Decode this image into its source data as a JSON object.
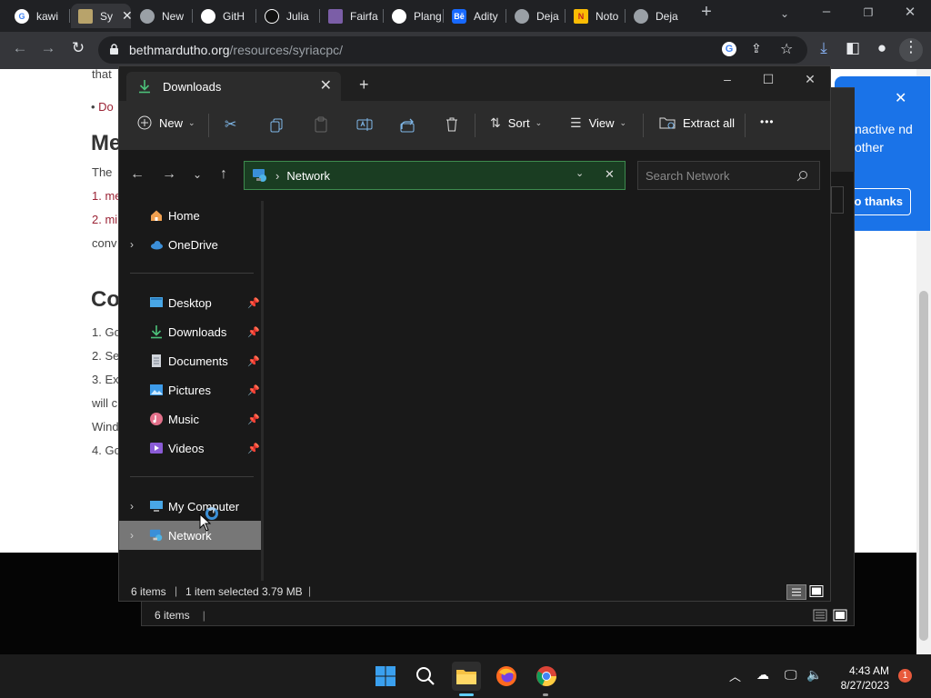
{
  "browser": {
    "tabs": [
      {
        "label": "kawi",
        "icon": "google-icon"
      },
      {
        "label": "Sy",
        "icon": "syriac-site-icon",
        "active": true
      },
      {
        "label": "New",
        "icon": "globe-icon"
      },
      {
        "label": "GitH",
        "icon": "github-icon"
      },
      {
        "label": "Julia",
        "icon": "julia-icon"
      },
      {
        "label": "Fairfa",
        "icon": "fairfax-icon"
      },
      {
        "label": "Plang",
        "icon": "github-icon"
      },
      {
        "label": "Adity",
        "icon": "behance-icon"
      },
      {
        "label": "Deja",
        "icon": "globe-icon"
      },
      {
        "label": "Noto",
        "icon": "noto-icon"
      },
      {
        "label": "Deja",
        "icon": "globe-icon"
      }
    ],
    "new_tab": "+",
    "url_host": "bethmardutho.org",
    "url_path": "/resources/syriacpc/"
  },
  "webpage": {
    "frag_that": "that",
    "frag_do": "Do",
    "heading_me": "Me",
    "frag_the": "The",
    "frag_1": "1. me",
    "frag_2": "2. mi",
    "frag_conv": "conv",
    "heading_co": "Co",
    "frag_go1": "1. Go",
    "frag_se": "2. Se",
    "frag_ex": "3. Ex",
    "frag_will": "will c",
    "frag_wind": "Wind",
    "frag_go4": "4. Go"
  },
  "chrome_popup": {
    "text": "nactive nd other",
    "button": "o thanks"
  },
  "explorer": {
    "tab_title": "Downloads",
    "commands": {
      "new": "New",
      "sort": "Sort",
      "view": "View",
      "extract_all": "Extract all",
      "more": "•••"
    },
    "address": "Network",
    "search_placeholder": "Search Network",
    "sidebar": {
      "home": "Home",
      "onedrive": "OneDrive",
      "desktop": "Desktop",
      "downloads": "Downloads",
      "documents": "Documents",
      "pictures": "Pictures",
      "music": "Music",
      "videos": "Videos",
      "my_computer": "My Computer",
      "network": "Network"
    },
    "status": {
      "items": "6 items",
      "selected": "1 item selected",
      "size": "3.79 MB"
    }
  },
  "back_window": {
    "status": "6 items"
  },
  "taskbar": {
    "time": "4:43 AM",
    "date": "8/27/2023",
    "notification_count": "1"
  },
  "colors": {
    "explorer_bg": "#191919",
    "selected_item": "#777777",
    "address_bar": "#1a3d22",
    "chrome_popup": "#1a73e8"
  }
}
